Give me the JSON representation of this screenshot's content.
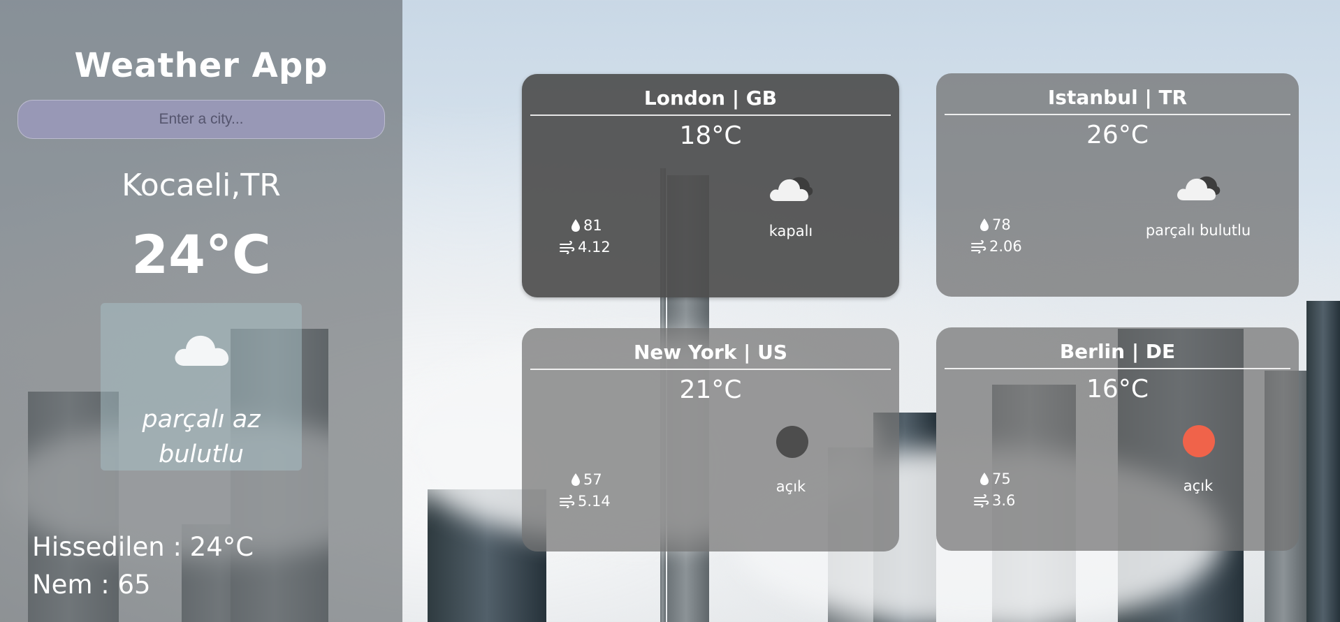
{
  "app": {
    "title": "Weather App"
  },
  "search": {
    "placeholder": "Enter a city..."
  },
  "current": {
    "city": "Kocaeli,TR",
    "temp": "24°C",
    "description_line1": "parçalı az",
    "description_line2": "bulutlu",
    "feels_like": "Hissedilen : 24°C",
    "humidity": "Nem : 65",
    "icon": "cloud-icon"
  },
  "cards": [
    {
      "title": "London | GB",
      "temp": "18°C",
      "humidity": "81",
      "wind": "4.12",
      "description": "kapalı",
      "icon": "broken-clouds-icon"
    },
    {
      "title": "Istanbul | TR",
      "temp": "26°C",
      "humidity": "78",
      "wind": "2.06",
      "description": "parçalı bulutlu",
      "icon": "broken-clouds-icon"
    },
    {
      "title": "New York | US",
      "temp": "21°C",
      "humidity": "57",
      "wind": "5.14",
      "description": "açık",
      "icon": "moon-icon",
      "icon_color": "#4d4d4d"
    },
    {
      "title": "Berlin | DE",
      "temp": "16°C",
      "humidity": "75",
      "wind": "3.6",
      "description": "açık",
      "icon": "sun-icon",
      "icon_color": "#f0634a"
    }
  ]
}
